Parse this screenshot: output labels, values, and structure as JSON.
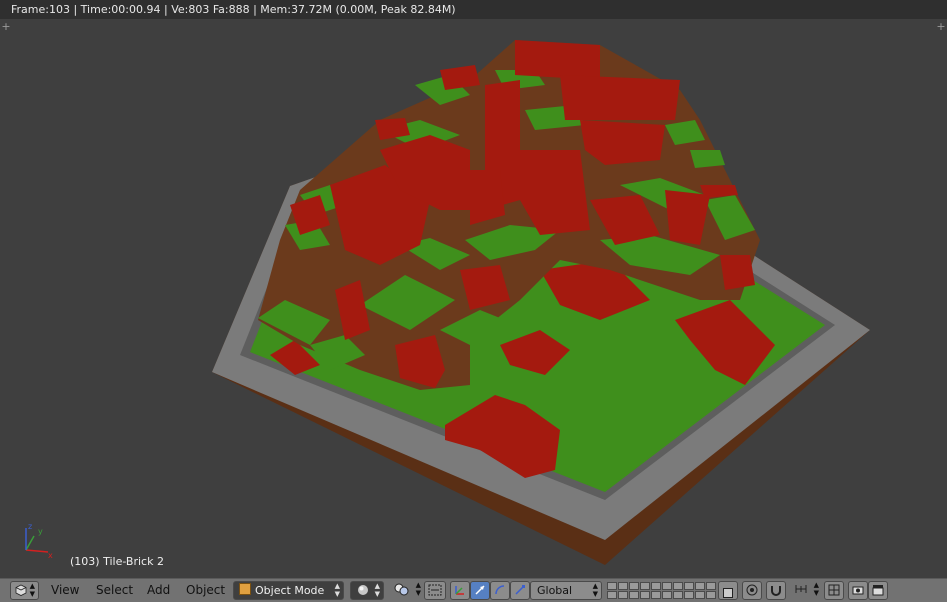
{
  "stats_bar": {
    "text": "Frame:103 | Time:00:00.94 | Ve:803 Fa:888 | Mem:37.72M (0.00M, Peak 82.84M)"
  },
  "viewport": {
    "object_label": "(103) Tile-Brick 2",
    "axis_labels": {
      "x": "x",
      "y": "y",
      "z": "z"
    }
  },
  "header": {
    "menus": [
      "View",
      "Select",
      "Add",
      "Object"
    ],
    "mode_label": "Object Mode",
    "orientation_label": "Global"
  },
  "icons": {
    "editor_type": "cube-view-icon",
    "shading": "sphere-shading-icon",
    "pivot": "pivot-icon",
    "manipulator": "manipulator-icon",
    "snap": "magnet-icon",
    "render": "camera-icon",
    "clapper": "clapper-icon"
  },
  "colors": {
    "grass": "#3f8f1c",
    "soil": "#6b3a1c",
    "brick": "#a41a0f",
    "rim": "#7d7d7d",
    "background": "#3f3f3f",
    "header": "#727272",
    "selected": "#5680c2"
  }
}
